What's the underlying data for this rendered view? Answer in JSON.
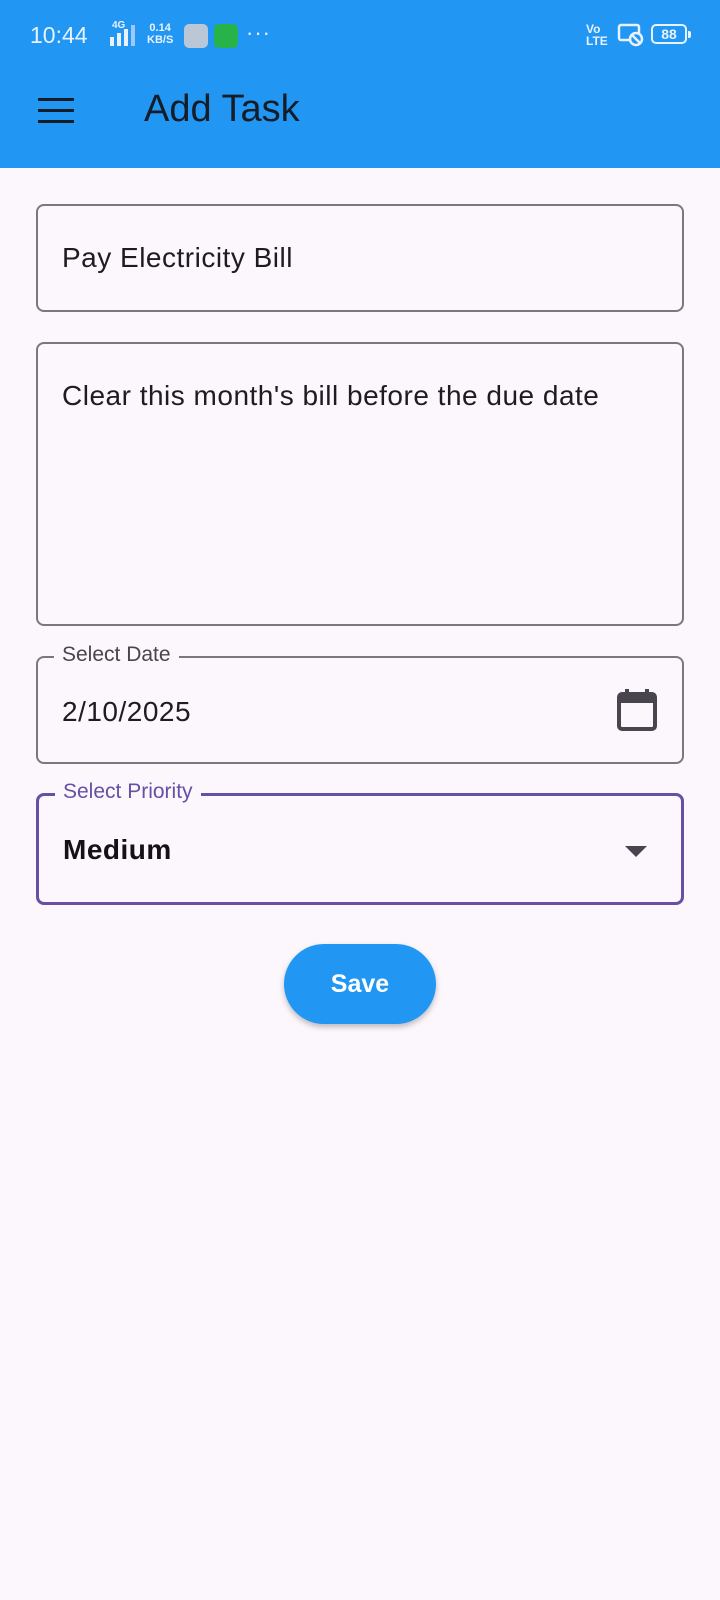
{
  "status_bar": {
    "time": "10:44",
    "network_type": "4G",
    "speed_value": "0.14",
    "speed_unit": "KB/S",
    "more": "···",
    "volte_top": "Vo",
    "volte_bottom": "LTE",
    "battery": "88"
  },
  "appbar": {
    "title": "Add Task",
    "menu_icon": "hamburger-menu-icon"
  },
  "form": {
    "task_title": {
      "value": "Pay Electricity Bill"
    },
    "task_description": {
      "value": "Clear this month's bill before the due date"
    },
    "date": {
      "label": "Select Date",
      "value": "2/10/2025",
      "icon": "calendar-icon"
    },
    "priority": {
      "label": "Select Priority",
      "value": "Medium",
      "icon": "dropdown-arrow-icon"
    }
  },
  "actions": {
    "save_label": "Save"
  },
  "colors": {
    "primary": "#2196f3",
    "focus_outline": "#6750a4",
    "background": "#fcf6fd"
  }
}
